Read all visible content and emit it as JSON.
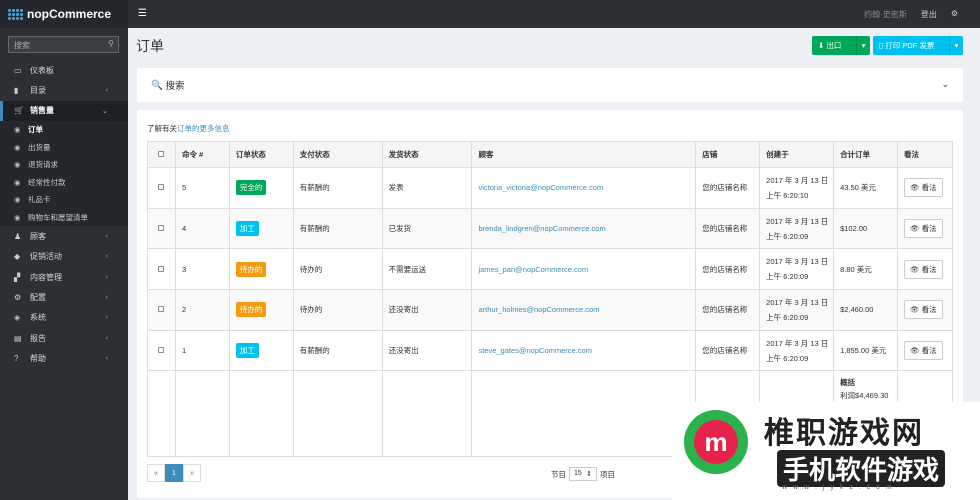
{
  "topbar": {
    "brand": "nopCommerce",
    "user": "约翰·史密斯",
    "logout": "登出"
  },
  "sidebar": {
    "search_placeholder": "搜索",
    "items": [
      {
        "label": "仪表板",
        "icon": "monitor-icon"
      },
      {
        "label": "目录",
        "icon": "book-icon"
      },
      {
        "label": "销售量",
        "icon": "cart-icon",
        "active": true
      },
      {
        "label": "顾客",
        "icon": "user-icon"
      },
      {
        "label": "促销活动",
        "icon": "tag-icon"
      },
      {
        "label": "内容管理",
        "icon": "cubes-icon"
      },
      {
        "label": "配置",
        "icon": "gears-icon"
      },
      {
        "label": "系统",
        "icon": "cube-icon"
      },
      {
        "label": "报告",
        "icon": "chart-icon"
      },
      {
        "label": "帮助",
        "icon": "question-icon"
      }
    ],
    "sales_sub": [
      "订单",
      "出货量",
      "退货请求",
      "经常性付款",
      "礼品卡",
      "购物车和愿望清单"
    ]
  },
  "page": {
    "title": "订单",
    "export_label": "出口",
    "pdf_label": "打印 PDF 发票",
    "search_label": "搜索",
    "info_prefix": "了解有关",
    "info_link": "订单的更多信息"
  },
  "table": {
    "headers": [
      "命令 #",
      "订单状态",
      "支付状态",
      "发货状态",
      "顾客",
      "店铺",
      "创建于",
      "合计订单",
      "看法"
    ],
    "rows": [
      {
        "id": "5",
        "status": "完全的",
        "status_color": "#00a65a",
        "pay": "有薪酬的",
        "ship": "发表",
        "customer": "victoria_victoria@nopCommerce.com",
        "store": "您的店铺名称",
        "date": "2017 年 3 月 13 日",
        "time": "上午 6:20:10",
        "total": "43.50 美元"
      },
      {
        "id": "4",
        "status": "加工",
        "status_color": "#00c0ef",
        "pay": "有薪酬的",
        "ship": "已发货",
        "customer": "brenda_lindgren@nopCommerce.com",
        "store": "您的店铺名称",
        "date": "2017 年 3 月 13 日",
        "time": "上午 6:20:09",
        "total": "$102.00"
      },
      {
        "id": "3",
        "status": "待办的",
        "status_color": "#f39c12",
        "pay": "待办的",
        "ship": "不需要运送",
        "customer": "james_pan@nopCommerce.com",
        "store": "您的店铺名称",
        "date": "2017 年 3 月 13 日",
        "time": "上午 6:20:09",
        "total": "8.80 美元"
      },
      {
        "id": "2",
        "status": "待办的",
        "status_color": "#f39c12",
        "pay": "待办的",
        "ship": "还没寄出",
        "customer": "arthur_holmes@nopCommerce.com",
        "store": "您的店铺名称",
        "date": "2017 年 3 月 13 日",
        "time": "上午 6:20:09",
        "total": "$2,460.00"
      },
      {
        "id": "1",
        "status": "加工",
        "status_color": "#00c0ef",
        "pay": "有薪酬的",
        "ship": "还没寄出",
        "customer": "steve_gates@nopCommerce.com",
        "store": "您的店铺名称",
        "date": "2017 年 3 月 13 日",
        "time": "上午 6:20:09",
        "total": "1,855.00 美元"
      }
    ],
    "view_label": "看法",
    "summary_title": "概括",
    "summary_profit": "利润$4,469.30"
  },
  "pager": {
    "prev": "«",
    "current": "1",
    "next": "»",
    "size_label_pre": "节目",
    "size_value": "15",
    "size_label_post": "项目"
  },
  "watermark": {
    "line1": "椎职游戏网",
    "line2": "手机软件游戏",
    "url": "w w w . j y k z . c o m",
    "logo_letter": "m"
  }
}
